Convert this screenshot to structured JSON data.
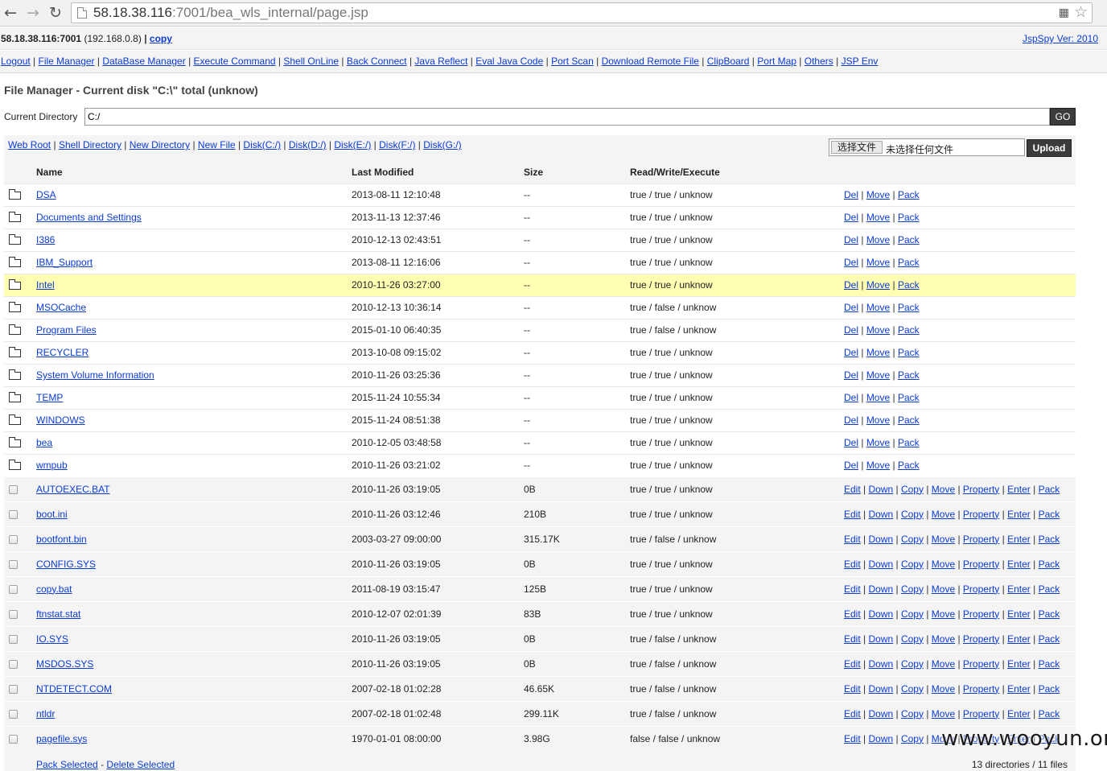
{
  "browser": {
    "url_host": "58.18.38.116",
    "url_rest": ":7001/bea_wls_internal/page.jsp"
  },
  "info": {
    "host_bold": "58.18.38.116:7001",
    "host_ip": "(192.168.0.8)",
    "copy_label": "copy",
    "version": "JspSpy Ver: 2010"
  },
  "menu": [
    "Logout",
    "File Manager",
    "DataBase Manager",
    "Execute Command",
    "Shell OnLine",
    "Back Connect",
    "Java Reflect",
    "Eval Java Code",
    "Port Scan",
    "Download Remote File",
    "ClipBoard",
    "Port Map",
    "Others",
    "JSP Env"
  ],
  "title": "File Manager - Current disk \"C:\\\" total (unknow)",
  "current_dir": {
    "label": "Current Directory",
    "value": "C:/",
    "go_label": "GO"
  },
  "dir_links": [
    "Web Root",
    "Shell Directory",
    "New Directory",
    "New File",
    "Disk(C:/)",
    "Disk(D:/)",
    "Disk(E:/)",
    "Disk(F:/)",
    "Disk(G:/)"
  ],
  "upload": {
    "choose_label": "选择文件",
    "no_file": "未选择任何文件",
    "upload_label": "Upload"
  },
  "columns": [
    "Name",
    "Last Modified",
    "Size",
    "Read/Write/Execute"
  ],
  "directories": [
    {
      "name": "DSA",
      "modified": "2013-08-11 12:10:48",
      "size": "--",
      "perm": "true / true / unknow"
    },
    {
      "name": "Documents and Settings",
      "modified": "2013-11-13 12:37:46",
      "size": "--",
      "perm": "true / true / unknow"
    },
    {
      "name": "I386",
      "modified": "2010-12-13 02:43:51",
      "size": "--",
      "perm": "true / true / unknow"
    },
    {
      "name": "IBM_Support",
      "modified": "2013-08-11 12:16:06",
      "size": "--",
      "perm": "true / true / unknow"
    },
    {
      "name": "Intel",
      "modified": "2010-11-26 03:27:00",
      "size": "--",
      "perm": "true / true / unknow"
    },
    {
      "name": "MSOCache",
      "modified": "2010-12-13 10:36:14",
      "size": "--",
      "perm": "true / false / unknow"
    },
    {
      "name": "Program Files",
      "modified": "2015-01-10 06:40:35",
      "size": "--",
      "perm": "true / false / unknow"
    },
    {
      "name": "RECYCLER",
      "modified": "2013-10-08 09:15:02",
      "size": "--",
      "perm": "true / true / unknow"
    },
    {
      "name": "System Volume Information",
      "modified": "2010-11-26 03:25:36",
      "size": "--",
      "perm": "true / true / unknow"
    },
    {
      "name": "TEMP",
      "modified": "2015-11-24 10:55:34",
      "size": "--",
      "perm": "true / true / unknow"
    },
    {
      "name": "WINDOWS",
      "modified": "2015-11-24 08:51:38",
      "size": "--",
      "perm": "true / true / unknow"
    },
    {
      "name": "bea",
      "modified": "2010-12-05 03:48:58",
      "size": "--",
      "perm": "true / true / unknow"
    },
    {
      "name": "wmpub",
      "modified": "2010-11-26 03:21:02",
      "size": "--",
      "perm": "true / true / unknow"
    }
  ],
  "highlighted_dir": "Intel",
  "dir_actions": [
    "Del",
    "Move",
    "Pack"
  ],
  "files": [
    {
      "name": "AUTOEXEC.BAT",
      "modified": "2010-11-26 03:19:05",
      "size": "0B",
      "perm": "true / true / unknow"
    },
    {
      "name": "boot.ini",
      "modified": "2010-11-26 03:12:46",
      "size": "210B",
      "perm": "true / true / unknow"
    },
    {
      "name": "bootfont.bin",
      "modified": "2003-03-27 09:00:00",
      "size": "315.17K",
      "perm": "true / false / unknow"
    },
    {
      "name": "CONFIG.SYS",
      "modified": "2010-11-26 03:19:05",
      "size": "0B",
      "perm": "true / true / unknow"
    },
    {
      "name": "copy.bat",
      "modified": "2011-08-19 03:15:47",
      "size": "125B",
      "perm": "true / true / unknow"
    },
    {
      "name": "ftnstat.stat",
      "modified": "2010-12-07 02:01:39",
      "size": "83B",
      "perm": "true / true / unknow"
    },
    {
      "name": "IO.SYS",
      "modified": "2010-11-26 03:19:05",
      "size": "0B",
      "perm": "true / false / unknow"
    },
    {
      "name": "MSDOS.SYS",
      "modified": "2010-11-26 03:19:05",
      "size": "0B",
      "perm": "true / false / unknow"
    },
    {
      "name": "NTDETECT.COM",
      "modified": "2007-02-18 01:02:28",
      "size": "46.65K",
      "perm": "true / false / unknow"
    },
    {
      "name": "ntldr",
      "modified": "2007-02-18 01:02:48",
      "size": "299.11K",
      "perm": "true / false / unknow"
    },
    {
      "name": "pagefile.sys",
      "modified": "1970-01-01 08:00:00",
      "size": "3.98G",
      "perm": "false / false / unknow"
    }
  ],
  "file_actions": [
    "Edit",
    "Down",
    "Copy",
    "Move",
    "Property",
    "Enter",
    "Pack"
  ],
  "footer": {
    "pack_selected": "Pack Selected",
    "delete_selected": "Delete Selected",
    "count": "13 directories / 11 files"
  },
  "watermark": "www.wooyun.org",
  "colors": {
    "link": "#0b3bd6",
    "highlight_row": "#ffffb4",
    "button_bg": "#3b3b3b",
    "panel_bg": "#f4f4f4"
  }
}
